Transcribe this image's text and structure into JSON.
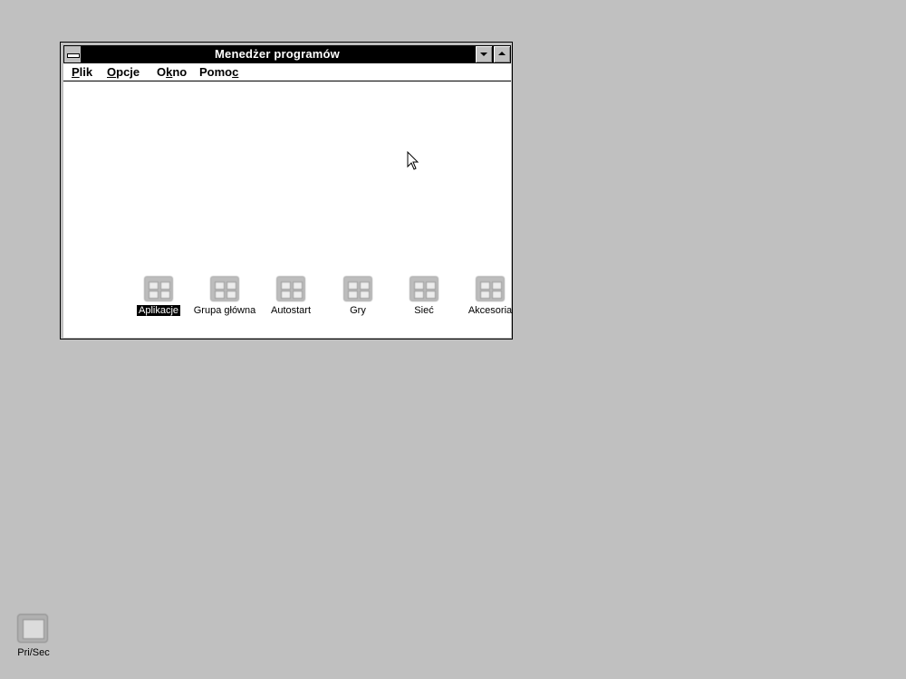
{
  "window": {
    "title": "Menedżer programów",
    "menus": [
      {
        "label": "Plik",
        "mnemonic": "P",
        "rest": "lik"
      },
      {
        "label": "Opcje",
        "mnemonic": "O",
        "rest": "pcje"
      },
      {
        "label": "Okno",
        "pre": "O",
        "mnemonic": "k",
        "rest": "no"
      },
      {
        "label": "Pomoc",
        "pre": "Pomo",
        "mnemonic": "c",
        "rest": ""
      }
    ],
    "groups": [
      {
        "label": "Aplikacje",
        "icon": "program-group-icon",
        "selected": true
      },
      {
        "label": "Grupa główna",
        "icon": "program-group-icon",
        "selected": false
      },
      {
        "label": "Autostart",
        "icon": "program-group-icon",
        "selected": false
      },
      {
        "label": "Gry",
        "icon": "program-group-icon",
        "selected": false
      },
      {
        "label": "Sieć",
        "icon": "program-group-icon",
        "selected": false
      },
      {
        "label": "Akcesoria",
        "icon": "program-group-icon",
        "selected": false
      }
    ]
  },
  "desktop": {
    "icons": [
      {
        "label": "Pri/Sec",
        "icon": "application-icon"
      }
    ]
  },
  "colors": {
    "desktop": "#c0c0c0",
    "titlebar_active": "#000000",
    "selection": "#000000"
  }
}
